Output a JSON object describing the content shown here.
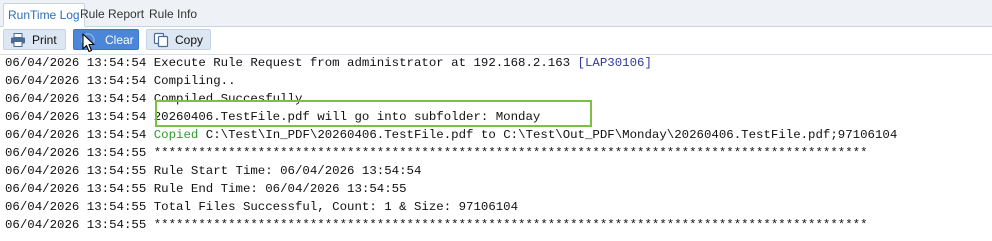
{
  "tabs": [
    {
      "label": "RunTime Log",
      "active": true
    },
    {
      "label": "Rule Report",
      "active": false
    },
    {
      "label": "Rule Info",
      "active": false
    }
  ],
  "toolbar": {
    "print_label": "Print",
    "clear_label": "Clear",
    "copy_label": "Copy"
  },
  "colors": {
    "accent_blue": "#4b86d8",
    "highlight_green": "#7cc042",
    "copied_green": "#2f9a2f",
    "tag_blue": "#2f3a9e"
  },
  "log": {
    "lines": [
      [
        {
          "t": "06/04/2026 13:54:54 Execute Rule Request from administrator at 192.168.2.163 "
        },
        {
          "t": "[LAP30106]",
          "c": "tag"
        }
      ],
      [
        {
          "t": "06/04/2026 13:54:54 Compiling.."
        }
      ],
      [
        {
          "t": "06/04/2026 13:54:54 Compiled Succesfully"
        }
      ],
      [
        {
          "t": "06/04/2026 13:54:54 20260406.TestFile.pdf will go into subfolder: Monday"
        }
      ],
      [
        {
          "t": "06/04/2026 13:54:54 "
        },
        {
          "t": "Copied",
          "c": "green"
        },
        {
          "t": " C:\\Test\\In_PDF\\20260406.TestFile.pdf to C:\\Test\\Out_PDF\\Monday\\20260406.TestFile.pdf;97106104"
        }
      ],
      [
        {
          "t": "06/04/2026 13:54:55 ************************************************************************************************"
        }
      ],
      [
        {
          "t": "06/04/2026 13:54:55 Rule Start Time: 06/04/2026 13:54:54"
        }
      ],
      [
        {
          "t": "06/04/2026 13:54:55 Rule End Time: 06/04/2026 13:54:55"
        }
      ],
      [
        {
          "t": "06/04/2026 13:54:55 Total Files Successful, Count: 1 & Size: 97106104"
        }
      ],
      [
        {
          "t": "06/04/2026 13:54:55 ************************************************************************************************"
        }
      ]
    ]
  }
}
